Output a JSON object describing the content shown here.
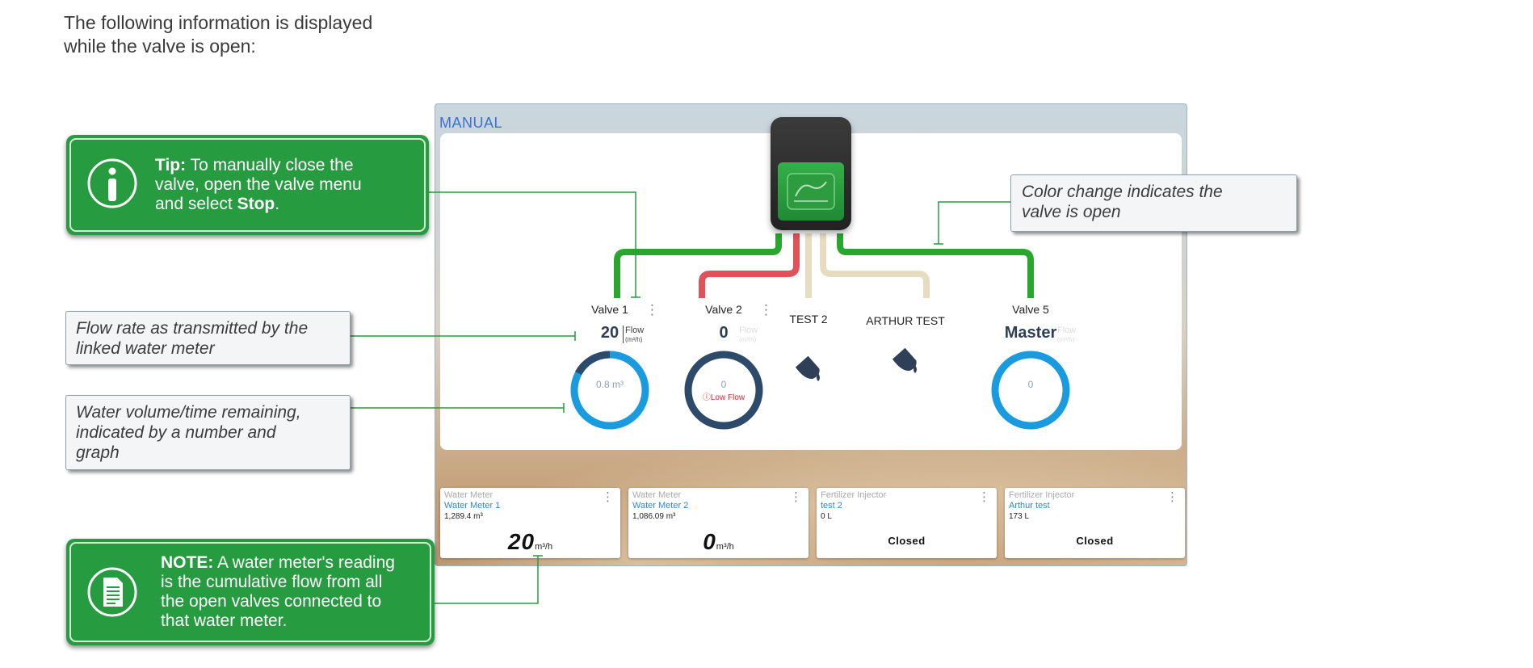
{
  "intro": {
    "line1": "The following information is displayed",
    "line2": "while the valve is open:"
  },
  "screen": {
    "mode": "MANUAL",
    "valves": [
      {
        "name": "Valve 1",
        "flow": "20",
        "flow_label": "Flow",
        "flow_unit": "(m³/h)",
        "remaining": "0.8 m³",
        "status": ""
      },
      {
        "name": "Valve 2",
        "flow": "0",
        "flow_label": "Flow",
        "flow_unit": "(m³/h)",
        "remaining": "0",
        "status": "Low Flow"
      },
      {
        "name": "Valve 5",
        "master": "Master",
        "flow_label": "Flow",
        "flow_unit": "(m³/h)",
        "remaining": "0"
      }
    ],
    "fertilizers": [
      {
        "name": "TEST 2"
      },
      {
        "name": "ARTHUR TEST"
      }
    ],
    "cards": [
      {
        "type": "Water Meter",
        "name": "Water Meter 1",
        "value": "1,289.4 m³",
        "big": "20",
        "unit": "m³/h"
      },
      {
        "type": "Water Meter",
        "name": "Water Meter 2",
        "value": "1,086.09 m³",
        "big": "0",
        "unit": "m³/h"
      },
      {
        "type": "Fertilizer Injector",
        "name": "test 2",
        "value": "0 L",
        "state": "Closed"
      },
      {
        "type": "Fertilizer Injector",
        "name": "Arthur test",
        "value": "173 L",
        "state": "Closed"
      }
    ],
    "pipe_colors": {
      "open": "#2aa52e",
      "warning": "#e0525a",
      "idle": "#e6dcc0"
    }
  },
  "callouts": {
    "tip": {
      "label": "Tip:",
      "line1": " To manually close the",
      "line2": "valve, open the valve menu",
      "line3_pre": "and select ",
      "line3_bold": "Stop",
      "line3_post": "."
    },
    "note": {
      "label": "NOTE:",
      "line1": " A water meter's reading",
      "line2": "is the cumulative flow from all",
      "line3": "the open valves connected to",
      "line4": "that water meter."
    },
    "flow_rate": {
      "line1": "Flow rate as transmitted by the",
      "line2": "linked water meter"
    },
    "water_volume": {
      "line1": "Water volume/time remaining,",
      "line2": "indicated by a number and",
      "line3": "graph"
    },
    "color_change": {
      "line1": "Color change indicates the",
      "line2": "valve is open"
    }
  }
}
